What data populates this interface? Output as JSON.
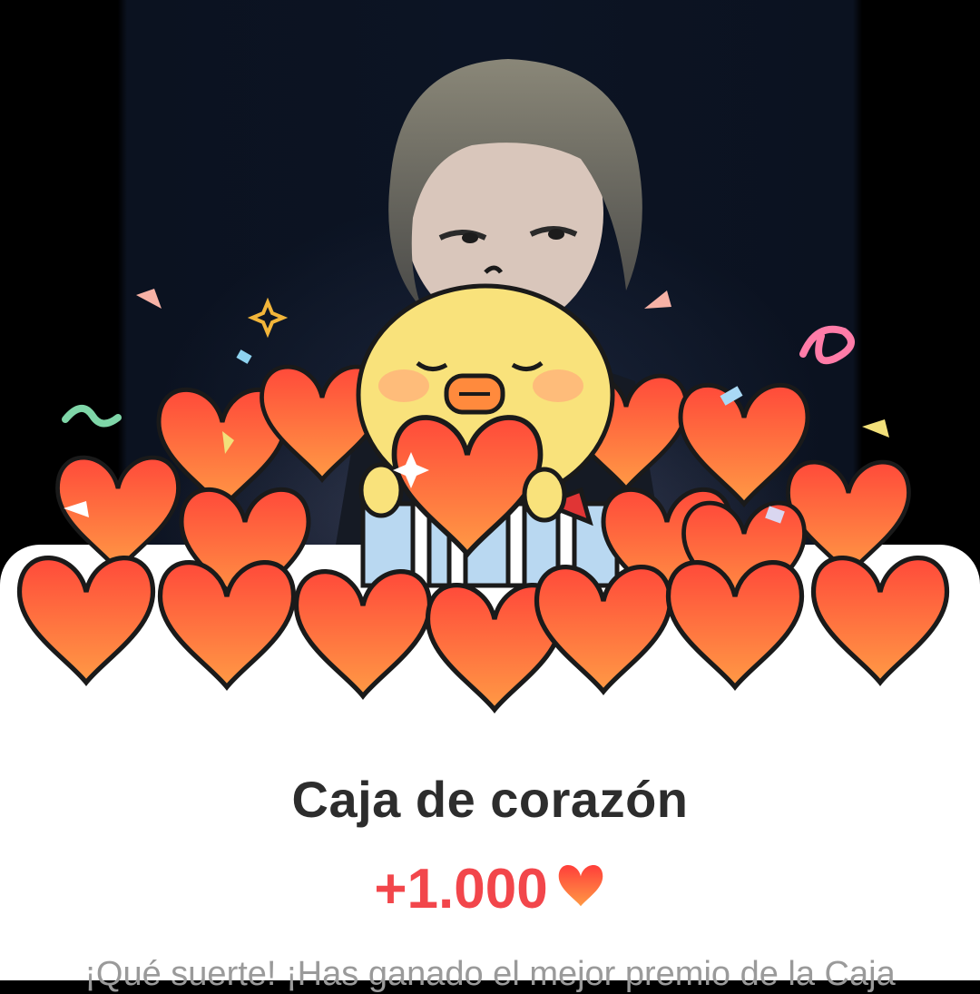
{
  "popup": {
    "title": "Caja de corazón",
    "reward_amount": "+1.000",
    "reward_icon": "heart-icon",
    "message": "¡Qué suerte! ¡Has ganado el mejor premio de la Caja"
  },
  "colors": {
    "sheet_background": "#ffffff",
    "title_text": "#2d2d2d",
    "reward_text": "#f2464b",
    "message_text": "#9a9a9a",
    "heart_fill": "#ff5b3d"
  }
}
